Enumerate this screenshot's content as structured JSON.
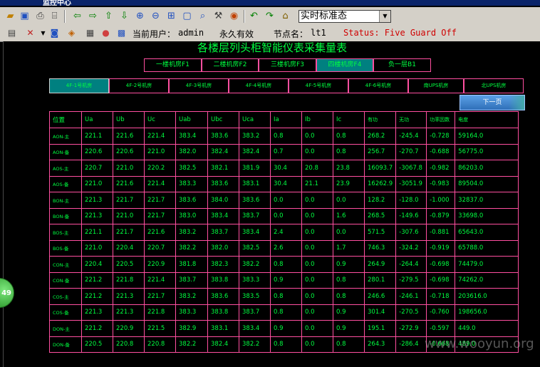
{
  "window": {
    "title": "监控中心"
  },
  "toolbar": {
    "view_select": "实时标准态",
    "current_user_label": "当前用户：",
    "current_user": "admin",
    "validity": "永久有效",
    "node_label": "节点名：",
    "node": "lt1",
    "status": "Status: Five Guard Off"
  },
  "page": {
    "title": "各楼层列头柜智能仪表采集量表",
    "floor_tabs": [
      "一楼机房F1",
      "二楼机房F2",
      "三楼机房F3",
      "四楼机房F4",
      "负一层B1"
    ],
    "room_tabs": [
      "4F-1号机房",
      "4F-2号机房",
      "4F-3号机房",
      "4F-4号机房",
      "4F-5号机房",
      "4F-6号机房",
      "南UPS机房",
      "北UPS机房"
    ],
    "next_page": "下一页",
    "badge": "49",
    "watermark": "www.wooyun.org"
  },
  "table": {
    "headers": [
      "位置",
      "Ua",
      "Ub",
      "Uc",
      "Uab",
      "Ubc",
      "Uca",
      "Ia",
      "Ib",
      "Ic",
      "有功",
      "无功",
      "功率因数",
      "电度"
    ],
    "rows": [
      [
        "AON-主",
        "221.1",
        "221.6",
        "221.4",
        "383.4",
        "383.6",
        "383.2",
        "0.8",
        "0.0",
        "0.8",
        "268.2",
        "-245.4",
        "-0.728",
        "59164.0"
      ],
      [
        "AON-备",
        "220.6",
        "220.6",
        "221.0",
        "382.0",
        "382.4",
        "382.4",
        "0.7",
        "0.0",
        "0.8",
        "256.7",
        "-270.7",
        "-0.688",
        "56775.0"
      ],
      [
        "AOS-主",
        "220.7",
        "221.0",
        "220.2",
        "382.5",
        "382.1",
        "381.9",
        "30.4",
        "20.8",
        "23.8",
        "16093.7",
        "-3067.8",
        "-0.982",
        "86203.0"
      ],
      [
        "AOS-备",
        "221.0",
        "221.6",
        "221.4",
        "383.3",
        "383.6",
        "383.1",
        "30.4",
        "21.1",
        "23.9",
        "16262.9",
        "-3051.9",
        "-0.983",
        "89504.0"
      ],
      [
        "BON-主",
        "221.3",
        "221.7",
        "221.7",
        "383.6",
        "384.0",
        "383.6",
        "0.0",
        "0.0",
        "0.0",
        "128.2",
        "-128.0",
        "-1.000",
        "32837.0"
      ],
      [
        "BON-备",
        "221.3",
        "221.0",
        "221.7",
        "383.0",
        "383.4",
        "383.7",
        "0.0",
        "0.0",
        "1.6",
        "268.5",
        "-149.6",
        "-0.879",
        "33698.0"
      ],
      [
        "BOS-主",
        "221.1",
        "221.7",
        "221.6",
        "383.2",
        "383.7",
        "383.4",
        "2.4",
        "0.0",
        "0.0",
        "571.5",
        "-307.6",
        "-0.881",
        "65643.0"
      ],
      [
        "BOS-备",
        "221.0",
        "220.4",
        "220.7",
        "382.2",
        "382.0",
        "382.5",
        "2.6",
        "0.0",
        "1.7",
        "746.3",
        "-324.2",
        "-0.919",
        "65788.0"
      ],
      [
        "CON-主",
        "220.4",
        "220.5",
        "220.9",
        "381.8",
        "382.3",
        "382.2",
        "0.8",
        "0.0",
        "0.9",
        "264.9",
        "-264.4",
        "-0.698",
        "74479.0"
      ],
      [
        "CON-备",
        "221.2",
        "221.8",
        "221.4",
        "383.7",
        "383.8",
        "383.3",
        "0.9",
        "0.0",
        "0.8",
        "280.1",
        "-279.5",
        "-0.698",
        "74262.0"
      ],
      [
        "COS-主",
        "221.2",
        "221.3",
        "221.7",
        "383.2",
        "383.6",
        "383.5",
        "0.8",
        "0.0",
        "0.8",
        "246.6",
        "-246.1",
        "-0.718",
        "203616.0"
      ],
      [
        "COS-备",
        "221.3",
        "221.3",
        "221.8",
        "383.3",
        "383.8",
        "383.7",
        "0.8",
        "0.0",
        "0.9",
        "301.4",
        "-270.5",
        "-0.760",
        "198656.0"
      ],
      [
        "DON-主",
        "221.2",
        "220.9",
        "221.5",
        "382.9",
        "383.1",
        "383.4",
        "0.9",
        "0.0",
        "0.9",
        "195.1",
        "-272.9",
        "-0.597",
        "449.0"
      ],
      [
        "DON-备",
        "220.5",
        "220.8",
        "220.8",
        "382.2",
        "382.4",
        "382.2",
        "0.8",
        "0.0",
        "0.8",
        "264.3",
        "-286.4",
        "-0.668",
        "489.0"
      ]
    ]
  }
}
